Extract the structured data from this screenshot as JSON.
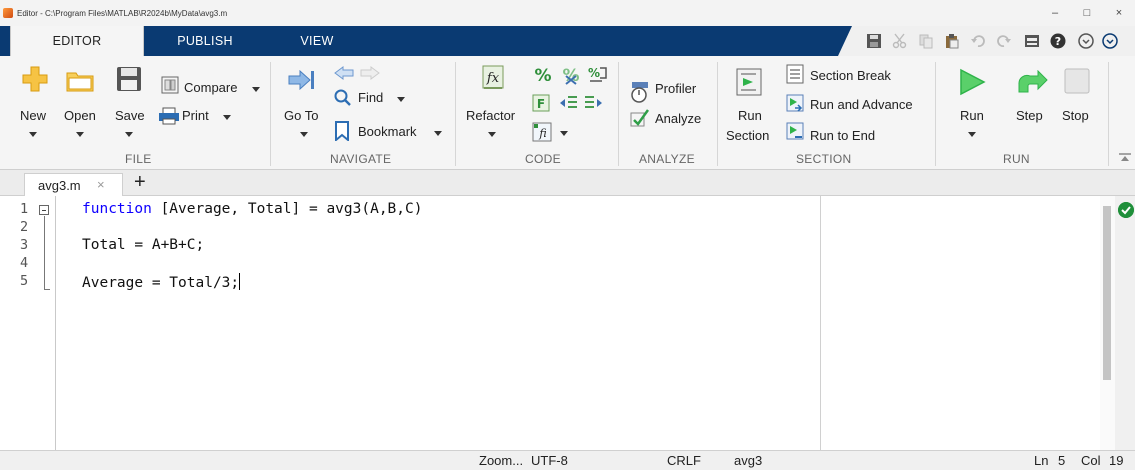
{
  "window": {
    "title": "Editor - C:\\Program Files\\MATLAB\\R2024b\\MyData\\avg3.m",
    "minimize_icon": "–",
    "maximize_icon": "□",
    "close_icon": "×"
  },
  "tabs": [
    {
      "label": "EDITOR",
      "active": true
    },
    {
      "label": "PUBLISH",
      "active": false
    },
    {
      "label": "VIEW",
      "active": false
    }
  ],
  "ribbon": {
    "file": {
      "section_label": "FILE",
      "new_label": "New",
      "open_label": "Open",
      "save_label": "Save",
      "compare_label": "Compare",
      "print_label": "Print"
    },
    "navigate": {
      "section_label": "NAVIGATE",
      "goto_label": "Go To",
      "find_label": "Find",
      "bookmark_label": "Bookmark"
    },
    "code": {
      "section_label": "CODE",
      "refactor_label": "Refactor"
    },
    "analyze": {
      "section_label": "ANALYZE",
      "profiler_label": "Profiler",
      "analyze_label": "Analyze"
    },
    "section": {
      "section_label": "SECTION",
      "run_section_label_1": "Run",
      "run_section_label_2": "Section",
      "section_break_label": "Section Break",
      "run_and_advance_label": "Run and Advance",
      "run_to_end_label": "Run to End"
    },
    "run": {
      "section_label": "RUN",
      "run_label": "Run",
      "step_label": "Step",
      "stop_label": "Stop"
    }
  },
  "doc_tabs": [
    {
      "name": "avg3.m",
      "close": "×"
    }
  ],
  "add_tab_label": "+",
  "editor": {
    "lines": [
      {
        "num": "1",
        "keyword": "function",
        "rest": " [Average, Total] = avg3(A,B,C)"
      },
      {
        "num": "2",
        "keyword": "",
        "rest": ""
      },
      {
        "num": "3",
        "keyword": "",
        "rest": "Total = A+B+C;"
      },
      {
        "num": "4",
        "keyword": "",
        "rest": ""
      },
      {
        "num": "5",
        "keyword": "",
        "rest": "Average = Total/3;"
      }
    ]
  },
  "statusbar": {
    "zoom": "Zoom...",
    "encoding": "UTF-8",
    "line_ending": "CRLF",
    "function_name": "avg3",
    "ln_label": "Ln",
    "ln_value": "5",
    "col_label": "Col",
    "col_value": "19"
  },
  "colors": {
    "tab_bar": "#0a3a72",
    "keyword": "#0e00ff",
    "run_green": "#2fb34a"
  }
}
